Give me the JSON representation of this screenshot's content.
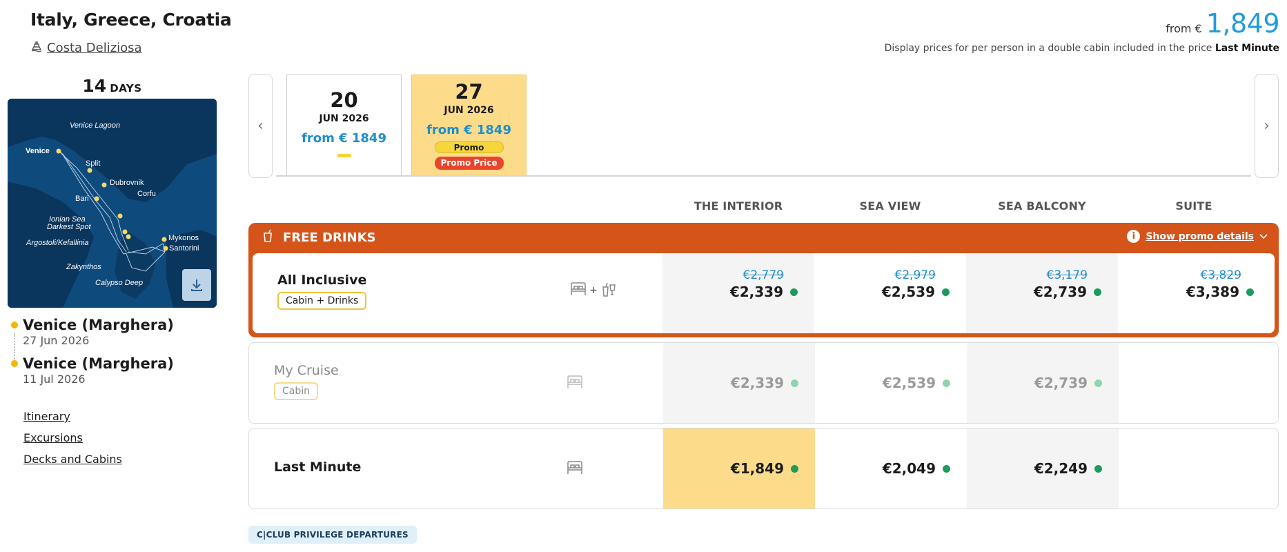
{
  "header": {
    "title": "Italy, Greece, Croatia",
    "ship_name": "Costa Deliziosa",
    "from_word": "from €",
    "price": "1,849",
    "disclaimer_text": "Display prices for per person in a double cabin included in the price",
    "disclaimer_bold": "Last Minute"
  },
  "itinerary": {
    "days_number": "14",
    "days_word": "DAYS",
    "map_labels": [
      "Venice Lagoon",
      "Venice",
      "Split",
      "Dubrovnik",
      "Corfu",
      "Bari",
      "Ionian Sea",
      "Darkest Spot",
      "Argostoli/Kefallinia",
      "Mykonos",
      "Santorini",
      "Zakynthos",
      "Calypso Deep"
    ],
    "departure": {
      "port": "Venice (Marghera)",
      "date": "27 Jun 2026"
    },
    "arrival": {
      "port": "Venice (Marghera)",
      "date": "11 Jul 2026"
    },
    "links": [
      "Itinerary",
      "Excursions",
      "Decks and Cabins"
    ]
  },
  "dates": [
    {
      "day": "20",
      "month": "JUN 2026",
      "price": "from € 1849"
    },
    {
      "day": "27",
      "month": "JUN 2026",
      "price": "from € 1849",
      "pill_promo": "Promo",
      "pill_price": "Promo Price"
    }
  ],
  "columns": [
    "THE INTERIOR",
    "SEA VIEW",
    "SEA BALCONY",
    "SUITE"
  ],
  "promo": {
    "title": "FREE DRINKS",
    "details_link": "Show promo details"
  },
  "rows": {
    "all_inclusive": {
      "label": "All Inclusive",
      "badge": "Cabin + Drinks",
      "plus": "+",
      "old_prices": [
        "€2,779",
        "€2,979",
        "€3,179",
        "€3,829"
      ],
      "prices": [
        "€2,339",
        "€2,539",
        "€2,739",
        "€3,389"
      ]
    },
    "my_cruise": {
      "label": "My Cruise",
      "badge": "Cabin",
      "prices": [
        "€2,339",
        "€2,539",
        "€2,739"
      ]
    },
    "last_minute": {
      "label": "Last Minute",
      "prices": [
        "€1,849",
        "€2,049",
        "€2,249"
      ]
    }
  },
  "cclub": "C|CLUB PRIVILEGE DEPARTURES",
  "colors": {
    "accent_blue": "#1f9be0",
    "promo_orange": "#d4541a",
    "highlight_yellow": "#fcdb8a",
    "available_green": "#1b9c5c"
  }
}
